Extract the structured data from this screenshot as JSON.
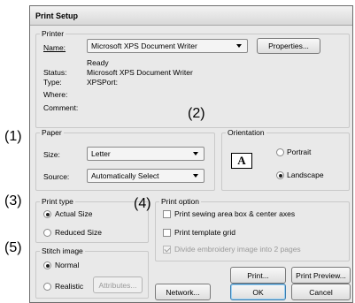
{
  "callouts": {
    "c1": "(1)",
    "c2": "(2)",
    "c3": "(3)",
    "c4": "(4)",
    "c5": "(5)"
  },
  "title": "Print Setup",
  "printer": {
    "legend": "Printer",
    "name_label": "Name:",
    "name_value": "Microsoft XPS Document Writer",
    "properties_button": "Properties...",
    "status_label": "Status:",
    "status_value": "Ready\nMicrosoft XPS Document Writer",
    "status_line1": "Ready",
    "status_line2": "Microsoft XPS Document Writer",
    "type_label": "Type:",
    "type_value": "XPSPort:",
    "where_label": "Where:",
    "where_value": "",
    "comment_label": "Comment:",
    "comment_value": ""
  },
  "paper": {
    "legend": "Paper",
    "size_label": "Size:",
    "size_value": "Letter",
    "source_label": "Source:",
    "source_value": "Automatically Select"
  },
  "orientation": {
    "legend": "Orientation",
    "portrait": "Portrait",
    "landscape": "Landscape",
    "selected": "Landscape",
    "icon_letter": "A"
  },
  "print_type": {
    "legend": "Print type",
    "actual_size": "Actual Size",
    "reduced_size": "Reduced Size",
    "selected": "Actual Size"
  },
  "stitch_image": {
    "legend": "Stitch image",
    "normal": "Normal",
    "realistic": "Realistic",
    "attributes_button": "Attributes...",
    "selected": "Normal"
  },
  "print_option": {
    "legend": "Print option",
    "opt1": "Print sewing area box & center axes",
    "opt2": "Print template grid",
    "opt3": "Divide embroidery image into 2 pages",
    "opt1_checked": false,
    "opt2_checked": false,
    "opt3_checked": true,
    "opt3_disabled": true
  },
  "buttons": {
    "print": "Print...",
    "print_preview": "Print Preview...",
    "network": "Network...",
    "ok": "OK",
    "cancel": "Cancel"
  }
}
